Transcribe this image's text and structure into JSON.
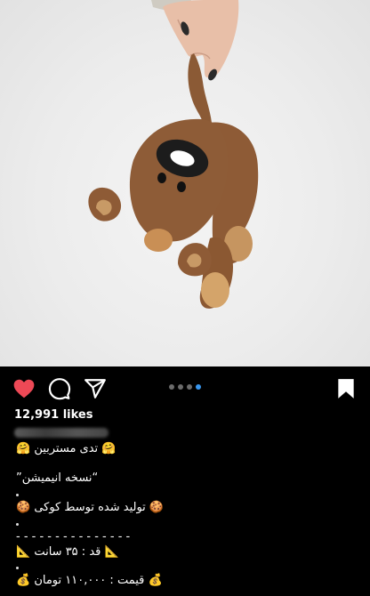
{
  "post": {
    "likes_text": "12,991 likes",
    "carousel": {
      "count": 4,
      "active_index": 3
    },
    "liked": true,
    "like_color": "#ed4956",
    "accent_dot_color": "#3897f0"
  },
  "caption": {
    "lines": [
      {
        "text": "🤗 تدی مستربین 🤗"
      },
      {
        "text": "“نسخه انیمیشن”"
      },
      {
        "text": "."
      },
      {
        "text": "🍪 تولید شده توسط کوکی 🍪"
      },
      {
        "text": "."
      },
      {
        "text": "- - - - - - - - - - - - - - -"
      },
      {
        "text": "📐 قد : ۳۵ سانت 📐"
      },
      {
        "text": "."
      },
      {
        "text": "💰 قیمت : ۱۱۰,۰۰۰ تومان 💰"
      }
    ]
  },
  "icons": {
    "like": "heart-icon",
    "comment": "comment-icon",
    "share": "send-icon",
    "save": "bookmark-icon"
  }
}
